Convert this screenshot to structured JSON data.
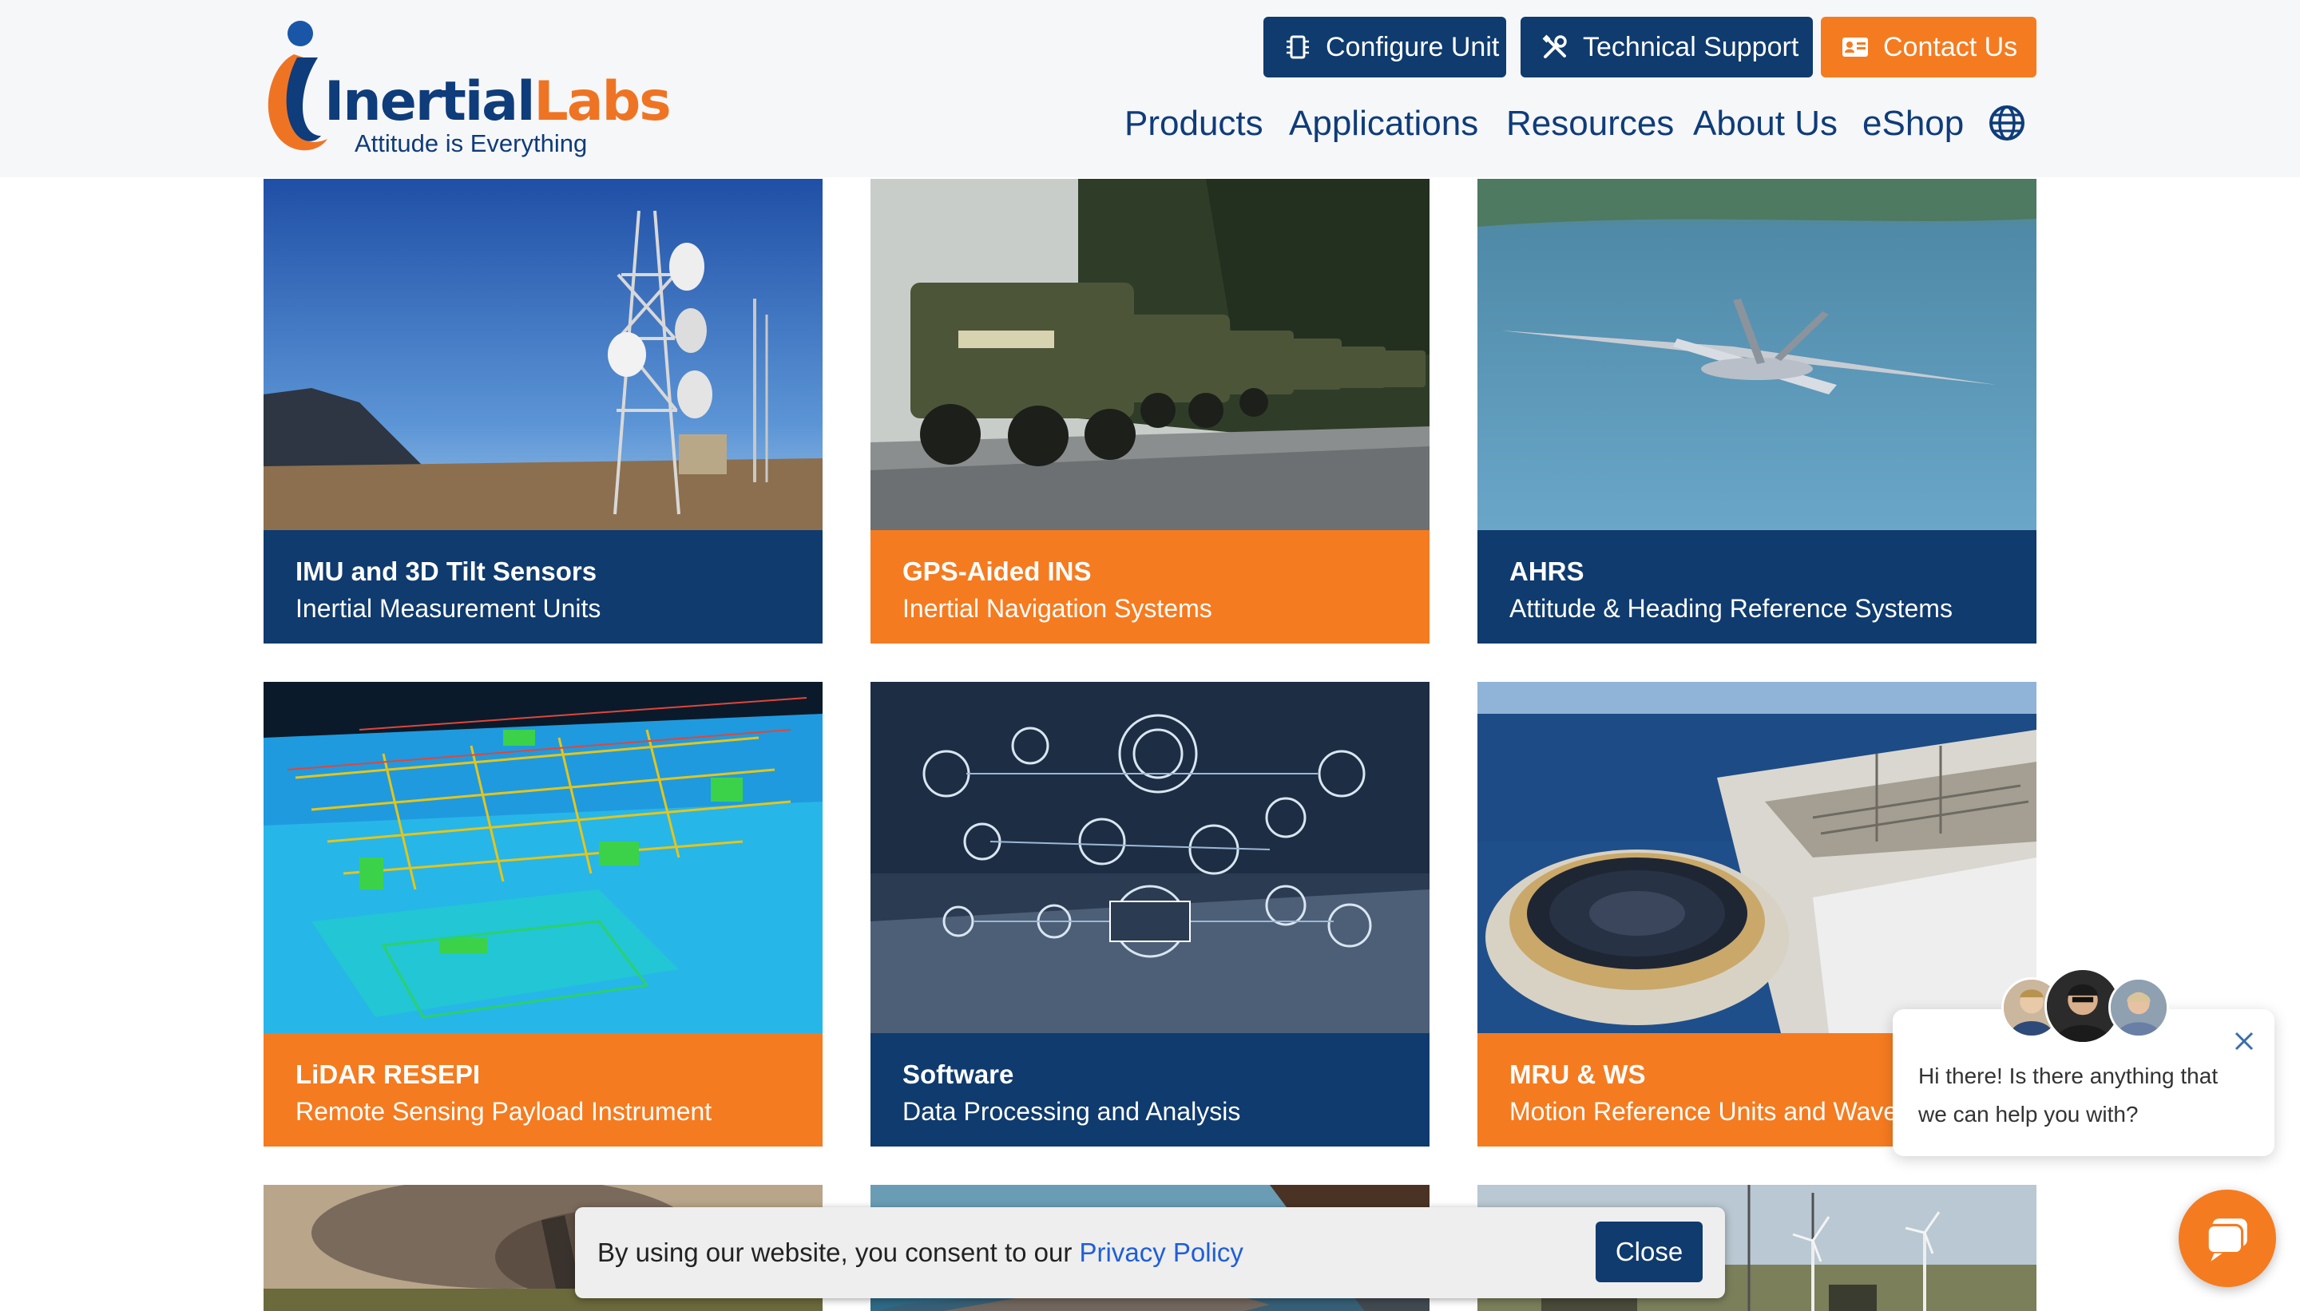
{
  "brand": {
    "name_part1": "Inertial",
    "name_part2": "Labs",
    "tagline": "Attitude is Everything"
  },
  "top_buttons": {
    "configure": "Configure Unit",
    "support": "Technical Support",
    "contact": "Contact Us"
  },
  "nav": {
    "items": [
      "Products",
      "Applications",
      "Resources",
      "About Us",
      "eShop"
    ],
    "language_icon": "globe-icon"
  },
  "cards": [
    {
      "title": "IMU and 3D Tilt Sensors",
      "subtitle": "Inertial Measurement Units",
      "style": "navy"
    },
    {
      "title": "GPS-Aided INS",
      "subtitle": "Inertial Navigation Systems",
      "style": "orange"
    },
    {
      "title": "AHRS",
      "subtitle": "Attitude & Heading Reference Systems",
      "style": "navy"
    },
    {
      "title": "LiDAR RESEPI",
      "subtitle": "Remote Sensing Payload Instrument",
      "style": "orange"
    },
    {
      "title": "Software",
      "subtitle": "Data Processing and Analysis",
      "style": "navy"
    },
    {
      "title": "MRU & WS",
      "subtitle": "Motion Reference Units and Wave Sensors",
      "style": "orange"
    }
  ],
  "chat": {
    "message": "Hi there! Is there anything that we can help you with?"
  },
  "cookie": {
    "text": "By using our website, you consent to our ",
    "link": "Privacy Policy",
    "close": "Close"
  },
  "colors": {
    "navy": "#0f3b6e",
    "orange": "#f57b20",
    "header_bg": "#f6f7f9"
  }
}
